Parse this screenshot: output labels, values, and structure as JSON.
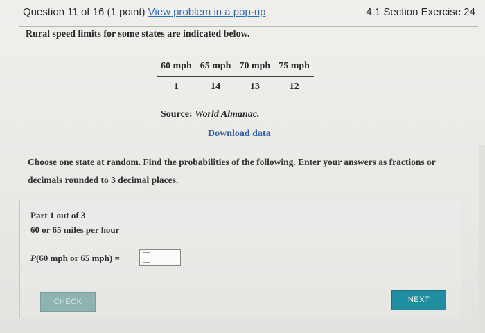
{
  "header": {
    "question_label": "Question 11 of 16 (1 point)",
    "popup_link": "View problem in a pop-up",
    "section": "4.1 Section Exercise 24"
  },
  "problem": {
    "intro": "Rural speed limits for some states are indicated below.",
    "table": {
      "headers": [
        "60 mph",
        "65 mph",
        "70 mph",
        "75 mph"
      ],
      "values": [
        "1",
        "14",
        "13",
        "12"
      ]
    },
    "source_label": "Source:",
    "source_name": "World Almanac.",
    "download_link": "Download data",
    "instructions": "Choose one state at random. Find the probabilities of the following. Enter your answers as fractions or decimals rounded to 3 decimal places."
  },
  "part": {
    "label": "Part 1 out of 3",
    "description": "60 or 65 miles per hour",
    "prob_prefix": "P",
    "prob_expression": "(60 mph or 65 mph) =",
    "answer_value": ""
  },
  "buttons": {
    "check": "CHECK",
    "next": "NEXT"
  }
}
